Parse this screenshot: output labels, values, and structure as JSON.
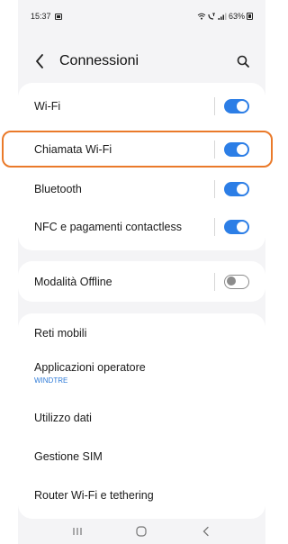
{
  "status": {
    "time": "15:37",
    "battery": "63%"
  },
  "header": {
    "title": "Connessioni"
  },
  "group1": [
    {
      "label": "Wi-Fi",
      "toggle": "on"
    },
    {
      "label": "Chiamata Wi-Fi",
      "toggle": "on"
    },
    {
      "label": "Bluetooth",
      "toggle": "on"
    },
    {
      "label": "NFC e pagamenti contactless",
      "toggle": "on"
    }
  ],
  "group2": [
    {
      "label": "Modalità Offline",
      "toggle": "off"
    }
  ],
  "group3": [
    {
      "label": "Reti mobili"
    },
    {
      "label": "Applicazioni operatore",
      "sub": "WINDTRE"
    },
    {
      "label": "Utilizzo dati"
    },
    {
      "label": "Gestione SIM"
    },
    {
      "label": "Router Wi-Fi e tethering"
    }
  ],
  "colors": {
    "accent": "#2c7ee6",
    "highlight": "#ea7a2a",
    "operator_sub": "#2f7bd8"
  },
  "icons": [
    "back-arrow-icon",
    "search-icon",
    "wifi-status-icon",
    "signal-icon",
    "battery-icon",
    "recents-icon",
    "home-icon",
    "back-nav-icon"
  ]
}
